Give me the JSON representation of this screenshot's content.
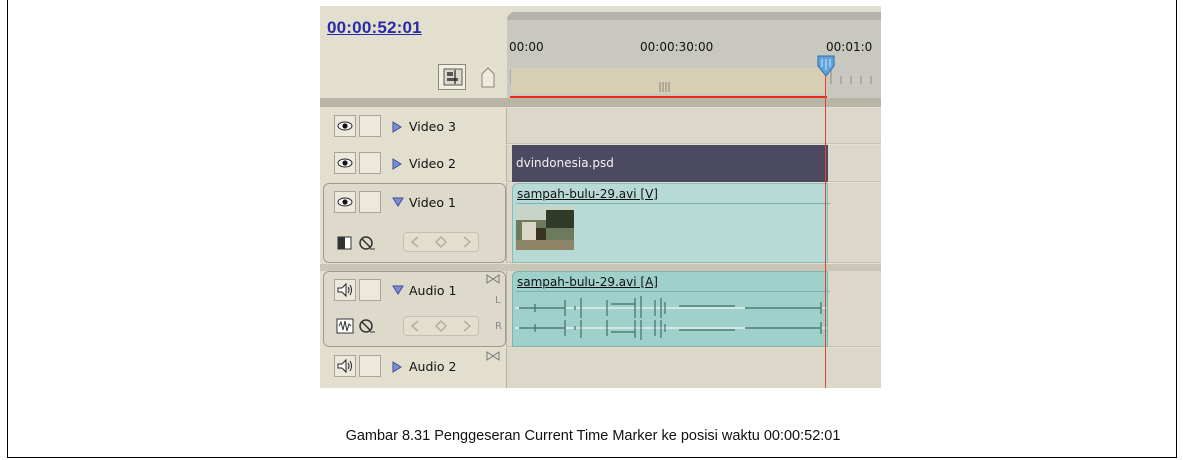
{
  "timecode": "00:00:52:01",
  "ruler": {
    "labels": [
      "00:00",
      "00:00:30:00",
      "00:01:0"
    ]
  },
  "tracks": [
    {
      "name": "Video 3",
      "type": "video",
      "expanded": false,
      "clip": ""
    },
    {
      "name": "Video 2",
      "type": "video",
      "expanded": false,
      "clip": "dvindonesia.psd"
    },
    {
      "name": "Video 1",
      "type": "video",
      "expanded": true,
      "clip": "sampah-bulu-29.avi [V]"
    },
    {
      "name": "Audio 1",
      "type": "audio",
      "expanded": true,
      "clip": "sampah-bulu-29.avi [A]",
      "channels": [
        "L",
        "R"
      ]
    },
    {
      "name": "Audio 2",
      "type": "audio",
      "expanded": false,
      "clip": ""
    }
  ],
  "caption": "Gambar 8.31 Penggeseran Current Time Marker ke posisi waktu 00:00:52:01",
  "colors": {
    "timecode": "#2a2aa6",
    "marker": "#ea2b1c",
    "video_clip": "#b7dad6",
    "still_clip": "#4b4a60",
    "audio_clip": "#9fd0c9"
  },
  "icons": [
    "eye-icon",
    "speaker-icon",
    "expand-triangle-icon",
    "snap-icon",
    "set-marker-icon",
    "display-style-icon",
    "keyframe-toggle-icon"
  ]
}
